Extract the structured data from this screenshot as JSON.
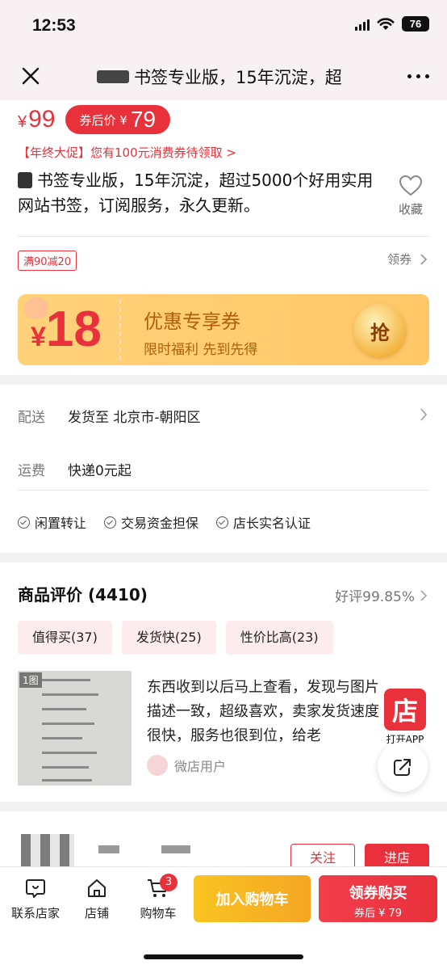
{
  "status_bar": {
    "time": "12:53",
    "battery": "76"
  },
  "nav": {
    "title": "书签专业版，15年沉淀，超"
  },
  "product": {
    "price": "99",
    "price_currency": "¥",
    "coupon_label": "券后价 ¥",
    "coupon_price": "79",
    "promo_text": "【年终大促】您有100元消费券待领取 >",
    "title": "书签专业版，15年沉淀，超过5000个好用实用网站书签，订阅服务，永久更新。",
    "favorite_label": "收藏",
    "discount_tag": "满90减20",
    "get_coupon_label": "领券",
    "big_coupon": {
      "currency": "¥",
      "amount": "18",
      "title": "优惠专享券",
      "subtitle": "限时福利 先到先得",
      "grab_label": "抢"
    }
  },
  "shipping": {
    "delivery_label": "配送",
    "delivery_value": "发货至  北京市-朝阳区",
    "freight_label": "运费",
    "freight_value": "快递0元起",
    "guarantees": [
      "闲置转让",
      "交易资金担保",
      "店长实名认证"
    ]
  },
  "reviews": {
    "title": "商品评价 (4410)",
    "rate": "好评99.85%",
    "tags": [
      "值得买(37)",
      "发货快(25)",
      "性价比高(23)"
    ],
    "item": {
      "image_badge": "1图",
      "text": "东西收到以后马上查看，发现与图片描述一致，超级喜欢，卖家发货速度很快，服务也很到位，给老",
      "user": "微店用户"
    }
  },
  "open_app": {
    "icon_text": "店",
    "label": "打开APP"
  },
  "shop": {
    "follow_label": "关注",
    "enter_label": "进店"
  },
  "bottom_bar": {
    "contact_label": "联系店家",
    "store_label": "店铺",
    "cart_label": "购物车",
    "cart_count": "3",
    "add_cart_label": "加入购物车",
    "buy_label": "领券购买",
    "buy_sub_label": "券后 ¥ 79"
  },
  "colors": {
    "accent": "#e8313b",
    "coupon_orange": "#f5a623"
  }
}
